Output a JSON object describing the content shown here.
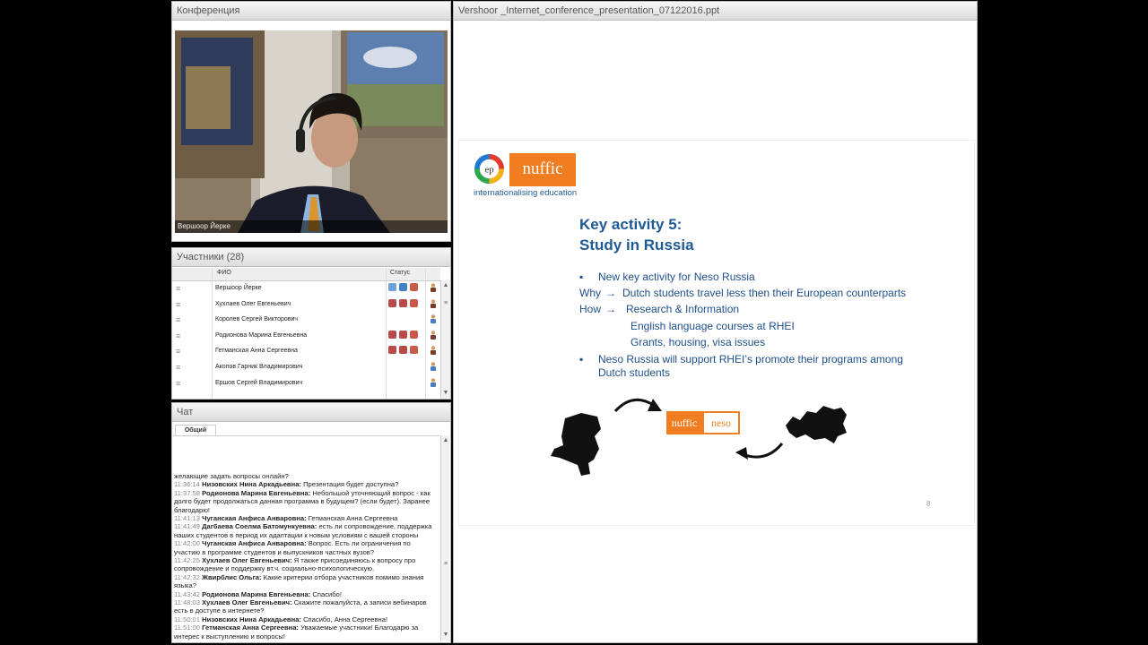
{
  "conference": {
    "title": "Конференция",
    "speaker_label": "Вершоор Йерке"
  },
  "participants": {
    "title": "Участники (28)",
    "col_name": "ФИО",
    "col_status": "Статус",
    "rows": [
      {
        "name": "Вершоор Йерке",
        "icons": [
          "status-a",
          "status-b",
          "status-c"
        ]
      },
      {
        "name": "Хухлаев Олег  Евгеньевич",
        "icons": [
          "status-d",
          "status-d",
          "status-c"
        ]
      },
      {
        "name": "Королев Сергей  Викторович",
        "icons": []
      },
      {
        "name": "Родионова Марина Евгеньевна",
        "icons": [
          "status-d",
          "status-d",
          "status-c"
        ]
      },
      {
        "name": "Гетманская Анна Сергеевна",
        "icons": [
          "status-d",
          "status-d",
          "status-c"
        ]
      },
      {
        "name": "Акопов  Гарник  Владимирович",
        "icons": []
      },
      {
        "name": "Ершов  Сергей  Владимирович",
        "icons": []
      }
    ]
  },
  "chat": {
    "title": "Чат",
    "tab": "Общий",
    "messages": [
      {
        "time": "",
        "author": "",
        "text": "желающие задать вопросы онлайн?"
      },
      {
        "time": "11:36:14",
        "author": "Низовских  Нина  Аркадьевна:",
        "text": "Презентация будет доступна?"
      },
      {
        "time": "11:37:58",
        "author": "Родионова Марина Евгеньевна:",
        "text": "Небольшой уточняющий вопрос - как долго будет продолжаться данная программа в будущем? (если будет). Заранее благодарю!"
      },
      {
        "time": "11:41:13",
        "author": "Чуганская  Анфиса  Анваровна:",
        "text": "Гетманская Анна Сергеевна"
      },
      {
        "time": "11:41:49",
        "author": "Дагбаева Соелма  Батомункуевна:",
        "text": "есть ли сопровождение, поддержка  наших студентов в период их адаптации к новым условиям с вашей стороны"
      },
      {
        "time": "11:42:00",
        "author": "Чуганская  Анфиса  Анваровна:",
        "text": "Вопрос. Есть ли ограничения по участию в программе студентов и выпускников частных вузов?"
      },
      {
        "time": "11:42:25",
        "author": "Хухлаев Олег  Евгеньевич:",
        "text": "Я также присоединяюсь к вопросу про сопровождение и поддержку вт.ч. социально-психологическую."
      },
      {
        "time": "11:42:32",
        "author": "Жвирблис Ольга:",
        "text": "Какие критерии отбора участников помимо знания языка?"
      },
      {
        "time": "11:43:42",
        "author": "Родионова Марина Евгеньевна:",
        "text": "Спасибо!"
      },
      {
        "time": "11:48:03",
        "author": "Хухлаев Олег  Евгеньевич:",
        "text": "Скажите пожалуйста, а записи вебинаров есть в доступе в интернете?"
      },
      {
        "time": "11:50:01",
        "author": "Низовских  Нина  Аркадьевна:",
        "text": "Спасибо, Анна Сергеевна!"
      },
      {
        "time": "11:51:00",
        "author": "Гетманская Анна Сергеевна:",
        "text": "Уважаемые участники! Благодарю за интерес к выступлению и вопросы!"
      }
    ]
  },
  "presentation": {
    "title": "Vershoor _Internet_conference_presentation_07122016.ppt",
    "logo_ep": "ep",
    "logo_nuffic": "nuffic",
    "logo_tagline": "internationalising education",
    "heading_line1": "Key activity 5:",
    "heading_line2": "Study in Russia",
    "bullet1": "New key activity for Neso Russia",
    "why_label": "Why",
    "why_text": "Dutch students travel less then their European counterparts",
    "how_label": "How",
    "how_text": "Research & Information",
    "how_sub1": "English language courses at RHEI",
    "how_sub2": "Grants, housing, visa issues",
    "bullet2_line1": "Neso Russia will support RHEI’s promote their programs among",
    "bullet2_line2": "Dutch students",
    "badge_nuffic": "nuffic",
    "badge_neso": "neso",
    "page_number": "8",
    "colors": {
      "nuffic_orange": "#f07d20",
      "heading_blue": "#1e5a96",
      "text_blue": "#1e4f8a"
    }
  }
}
